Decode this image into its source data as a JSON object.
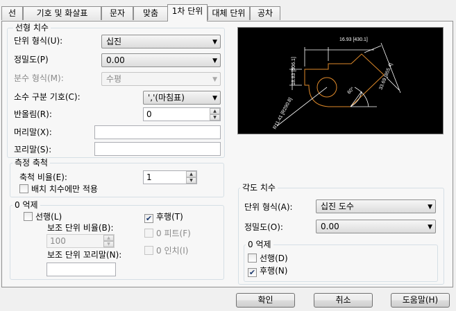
{
  "tabs": [
    {
      "label": "선",
      "active": false
    },
    {
      "label": "기호 및 화살표",
      "active": false
    },
    {
      "label": "문자",
      "active": false
    },
    {
      "label": "맞춤",
      "active": false
    },
    {
      "label": "1차 단위",
      "active": true
    },
    {
      "label": "대체 단위",
      "active": false
    },
    {
      "label": "공차",
      "active": false
    }
  ],
  "linear": {
    "title": "선형 치수",
    "unit_format": {
      "label": "단위 형식(U):",
      "value": "십진"
    },
    "precision": {
      "label": "정밀도(P)",
      "value": "0.00"
    },
    "fraction_format": {
      "label": "분수 형식(M):",
      "value": "수평"
    },
    "decimal_separator": {
      "label": "소수 구분 기호(C):",
      "value": "','(마침표)"
    },
    "round_off": {
      "label": "반올림(R):",
      "value": "0"
    },
    "prefix": {
      "label": "머리말(X):",
      "value": ""
    },
    "suffix": {
      "label": "꼬리말(S):",
      "value": ""
    }
  },
  "scale": {
    "title": "측정 축척",
    "scale_factor": {
      "label": "축척 비율(E):",
      "value": "1"
    },
    "layout_only": {
      "label": "배치 치수에만 적용",
      "checked": false
    }
  },
  "zero_suppression": {
    "title": "0 억제",
    "leading": {
      "label": "선행(L)",
      "checked": false
    },
    "trailing": {
      "label": "후행(T)",
      "checked": true
    },
    "sub_unit_factor": {
      "label": "보조 단위 비율(B):",
      "value": "100"
    },
    "sub_unit_suffix": {
      "label": "보조 단위 꼬리말(N):",
      "value": ""
    },
    "feet": {
      "label": "0 피트(F)",
      "checked": false
    },
    "inches": {
      "label": "0 인치(I)",
      "checked": false
    }
  },
  "angular": {
    "title": "각도 치수",
    "unit_format": {
      "label": "단위 형식(A):",
      "value": "십진 도수"
    },
    "precision": {
      "label": "정밀도(O):",
      "value": "0.00"
    },
    "zero_title": "0 억제",
    "leading": {
      "label": "선행(D)",
      "checked": false
    },
    "trailing": {
      "label": "후행(N)",
      "checked": true
    }
  },
  "preview": {
    "dim_top": "16.93 [430.1]",
    "dim_left": "18.83 [506.1]",
    "dim_right": "33.69 [855.4]",
    "dim_radius": "R11.41 [R290.8]",
    "dim_angle": "60°",
    "colors": {
      "background": "#000000",
      "geometry": "#e08a2a",
      "dimension": "#ffffff"
    }
  },
  "buttons": {
    "ok": "확인",
    "cancel": "취소",
    "help": "도움말(H)"
  }
}
